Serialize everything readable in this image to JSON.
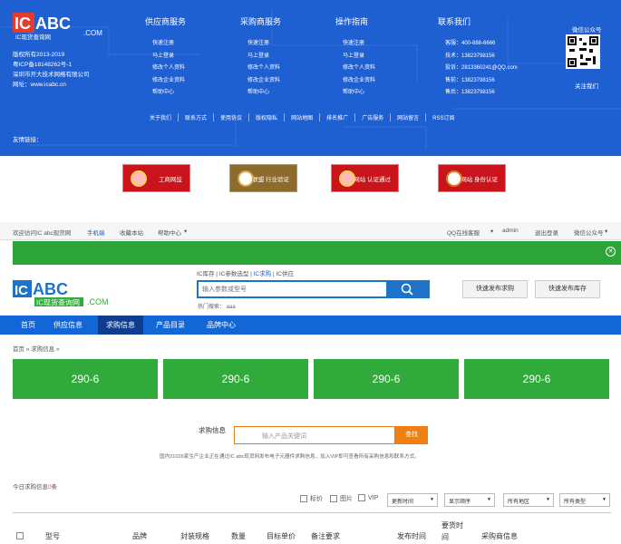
{
  "footer": {
    "logo_text": "ICABC",
    "logo_sub": "IC现货查询网",
    "logo_com": ".COM",
    "info": [
      "版权所有2013-2019",
      "粤ICP备18148262号-1",
      "深圳市开大技术网络有限公司",
      "网址：www.icabc.cn"
    ],
    "columns": [
      {
        "title": "供应商服务",
        "items": [
          "快速注册",
          "马上登录",
          "修改个人资料",
          "修改企业资料",
          "帮助中心"
        ]
      },
      {
        "title": "采购商服务",
        "items": [
          "快速注册",
          "马上登录",
          "修改个人资料",
          "修改企业资料",
          "帮助中心"
        ]
      },
      {
        "title": "操作指南",
        "items": [
          "快速注册",
          "马上登录",
          "修改个人资料",
          "修改企业资料",
          "帮助中心"
        ]
      },
      {
        "title": "联系我们",
        "items": [
          "客服：400-888-6666",
          "技术：13823798156",
          "投诉：2813360241@QQ.com",
          "售前：13823798156",
          "售后：13823798156"
        ]
      }
    ],
    "qr_title": "微信公众号",
    "qr_caption": "关注我们",
    "links": [
      "关于我们",
      "联系方式",
      "使用协议",
      "版权隐私",
      "网站地图",
      "排名推广",
      "广告服务",
      "网站留言",
      "RSS订阅"
    ],
    "friend_links": "友情链接："
  },
  "badges": [
    "工商网监",
    "安全联盟 行业验证",
    "实名网站 认证通过",
    "可信网站 身份认证"
  ],
  "topbar": {
    "welcome": "欢迎访问IC abc现货网",
    "mobile": "手机端",
    "fav": "收藏本站",
    "help": "帮助中心",
    "qq": "QQ在线客服",
    "user": "admin",
    "logout": "退出登录",
    "wechat": "微信公众号"
  },
  "header": {
    "tabs": [
      "IC库存",
      "IC参数选型",
      "IC求购",
      "IC供应"
    ],
    "search_placeholder": "输入参数或型号",
    "hot": "热门搜索：  aaa",
    "btn_publish_buy": "快速发布求购",
    "btn_publish_stock": "快速发布库存"
  },
  "nav": [
    "首页",
    "供应信息",
    "求购信息",
    "产品目录",
    "品牌中心"
  ],
  "breadcrumb": "首页 » 求购信息 »",
  "green_boxes": [
    "290-6",
    "290-6",
    "290-6",
    "290-6"
  ],
  "query": {
    "label": "求购信息",
    "placeholder": "输入产品关键词",
    "button": "查找"
  },
  "note": "国内21026家生产企业正在通过IC abc现货网发布电子元器件求购信息，加入VIP即可查看所有采购信息和联系方式。",
  "today": {
    "prefix": "今日求购信息",
    "count": "0",
    "suffix": "条"
  },
  "filters": {
    "checks": [
      "标价",
      "图片",
      "VIP"
    ],
    "selects": [
      "更新时间",
      "显示顺序",
      "所有地区",
      "所有类型"
    ]
  },
  "table_headers": [
    "型号",
    "品牌",
    "封装规格",
    "数量",
    "目标单价",
    "备注要求",
    "发布时间",
    "要货时间",
    "采购商信息"
  ]
}
